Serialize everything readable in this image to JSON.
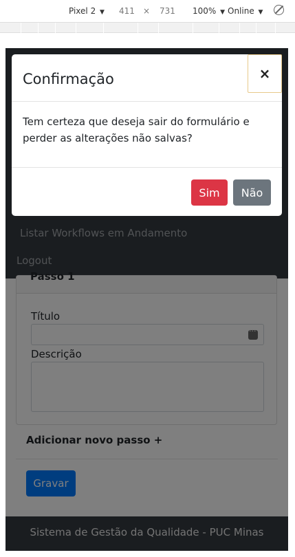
{
  "devtools": {
    "device": "Pixel 2",
    "width": "411",
    "times": "×",
    "height": "731",
    "zoom": "100%",
    "network": "Online",
    "caret": "▼"
  },
  "nav": {
    "workflows": "Listar Workflows em Andamento",
    "logout": "Logout"
  },
  "form": {
    "step_header": "Passo 1",
    "title_label": "Título",
    "title_value": "",
    "description_label": "Descrição",
    "description_value": "",
    "add_step": "Adicionar novo passo +",
    "save": "Gravar"
  },
  "footer": {
    "text": "Sistema de Gestão da Qualidade - PUC Minas"
  },
  "modal": {
    "title": "Confirmação",
    "close": "×",
    "message": "Tem certeza que deseja sair do formulário e perder as alterações não salvas?",
    "yes": "Sim",
    "no": "Não"
  },
  "colors": {
    "danger": "#dc3545",
    "secondary": "#6c757d",
    "primary": "#007bff",
    "navbar": "#343a40"
  }
}
